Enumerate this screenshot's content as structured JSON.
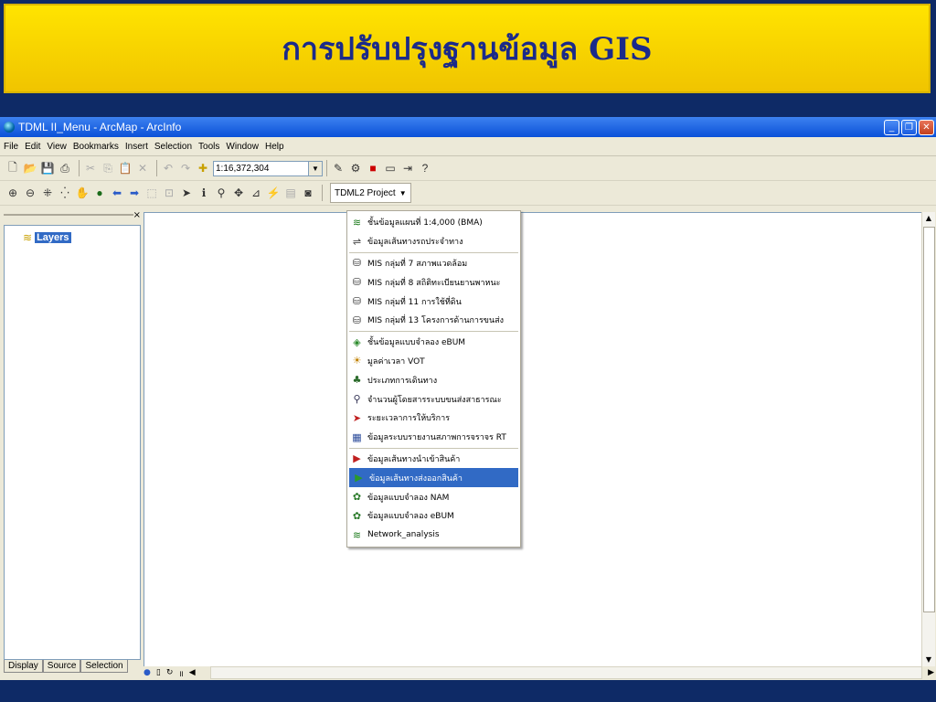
{
  "banner": {
    "title": "การปรับปรุงฐานข้อมูล GIS"
  },
  "window": {
    "title": "TDML II_Menu - ArcMap - ArcInfo"
  },
  "menubar": [
    "File",
    "Edit",
    "View",
    "Bookmarks",
    "Insert",
    "Selection",
    "Tools",
    "Window",
    "Help"
  ],
  "toolbar": {
    "scale_value": "1:16,372,304",
    "project_menu_label": "TDML2 Project"
  },
  "toc": {
    "layers_label": "Layers",
    "tabs": [
      "Display",
      "Source",
      "Selection"
    ]
  },
  "project_menu": {
    "items": [
      {
        "label": "ชั้นข้อมูลแผนที่ 1:4,000 (BMA)",
        "icon": "layers-icon"
      },
      {
        "label": "ข้อมูลเส้นทางรถประจำทาง",
        "icon": "bus-route-icon"
      },
      {
        "separator": true
      },
      {
        "label": "MIS กลุ่มที่ 7 สภาพแวดล้อม",
        "icon": "database-icon"
      },
      {
        "label": "MIS กลุ่มที่ 8 สถิติทะเบียนยานพาหนะ",
        "icon": "database-icon"
      },
      {
        "label": "MIS กลุ่มที่ 11 การใช้ที่ดิน",
        "icon": "database-icon"
      },
      {
        "label": "MIS กลุ่มที่ 13 โครงการด้านการขนส่ง",
        "icon": "database-icon"
      },
      {
        "separator": true
      },
      {
        "label": "ชั้นข้อมูลแบบจำลอง eBUM",
        "icon": "model-icon"
      },
      {
        "label": "มูลค่าเวลา VOT",
        "icon": "value-icon"
      },
      {
        "label": "ประเภทการเดินทาง",
        "icon": "travel-type-icon"
      },
      {
        "label": "จำนวนผู้โดยสารระบบขนส่งสาธารณะ",
        "icon": "passenger-icon"
      },
      {
        "label": "ระยะเวลาการให้บริการ",
        "icon": "service-time-icon"
      },
      {
        "label": "ข้อมูลระบบรายงานสภาพการจราจร RT",
        "icon": "traffic-report-icon"
      },
      {
        "separator": true
      },
      {
        "label": "ข้อมูลเส้นทางนำเข้าสินค้า",
        "icon": "import-route-icon"
      },
      {
        "label": "ข้อมูลเส้นทางส่งออกสินค้า",
        "icon": "export-route-icon",
        "selected": true
      },
      {
        "label": "ข้อมูลแบบจำลอง NAM",
        "icon": "nam-model-icon"
      },
      {
        "label": "ข้อมูลแบบจำลอง eBUM",
        "icon": "ebum-model-icon"
      },
      {
        "label": "Network_analysis",
        "icon": "network-icon"
      }
    ]
  }
}
